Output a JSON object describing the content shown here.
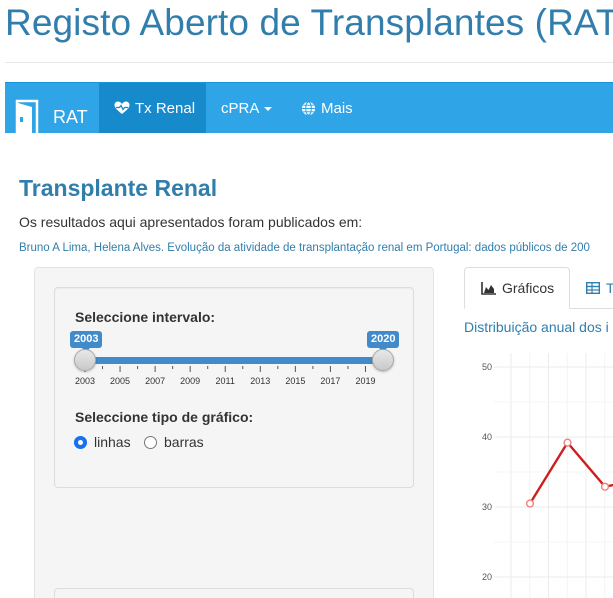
{
  "app": {
    "title": "Registo Aberto de Transplantes (RAT)"
  },
  "navbar": {
    "brand": "RAT",
    "items": [
      {
        "label": "Tx Renal",
        "icon": "heart-pulse-icon",
        "active": true
      },
      {
        "label": "cPRA",
        "icon": "caret-down-icon",
        "active": false
      },
      {
        "label": "Mais",
        "icon": "globe-icon",
        "active": false
      }
    ],
    "colors": {
      "bar": "#2fa4e7",
      "active": "#178acc"
    }
  },
  "page": {
    "title": "Transplante Renal",
    "intro": "Os resultados aqui apresentados foram publicados em:",
    "citation": "Bruno A Lima, Helena Alves. Evolução da atividade de transplantação renal em Portugal: dados públicos de 200"
  },
  "sidebar": {
    "interval_label": "Seleccione intervalo:",
    "slider": {
      "min": 2003,
      "max": 2020,
      "from": 2003,
      "to": 2020,
      "from_label": "2003",
      "to_label": "2020",
      "tick_labels": [
        "2003",
        "2005",
        "2007",
        "2009",
        "2011",
        "2013",
        "2015",
        "2017",
        "2019"
      ]
    },
    "chart_type_label": "Seleccione tipo de gráfico:",
    "chart_type_options": [
      {
        "label": "linhas",
        "checked": true
      },
      {
        "label": "barras",
        "checked": false
      }
    ]
  },
  "main": {
    "tabs": [
      {
        "label": "Gráficos",
        "icon": "area-chart-icon",
        "active": true
      },
      {
        "label": "T",
        "icon": "table-icon",
        "active": false
      }
    ],
    "chart_heading": "Distribuição anual dos i"
  },
  "chart_data": {
    "type": "line",
    "title": "",
    "xlabel": "",
    "ylabel": "",
    "y_ticks": [
      "50",
      "40",
      "30",
      "20"
    ],
    "ylim": [
      20,
      50
    ],
    "x": [
      2003,
      2004,
      2005,
      2006
    ],
    "series": [
      {
        "values": [
          30.5,
          39.2,
          32.9,
          34.0
        ]
      }
    ],
    "grid": true,
    "line_color": "#cc1f1f"
  }
}
